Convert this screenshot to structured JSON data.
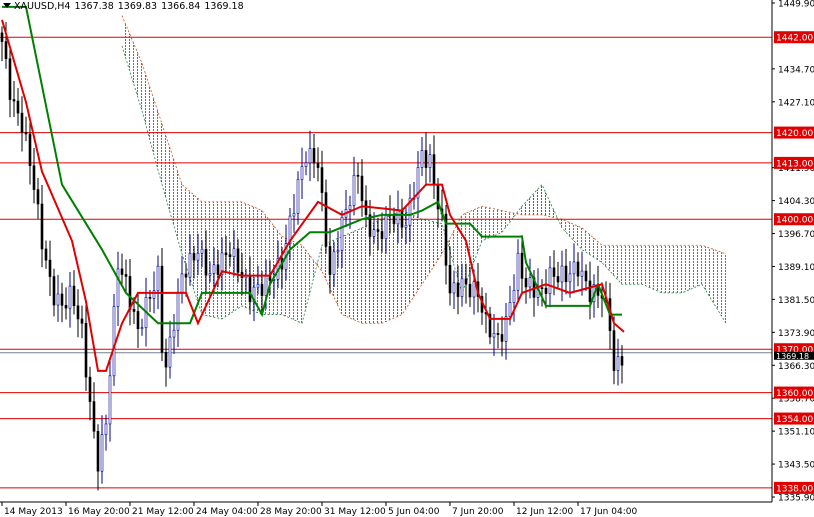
{
  "header": {
    "symbol": "XAUUSD,H4",
    "open": "1367.38",
    "high": "1369.83",
    "low": "1366.84",
    "close": "1369.18"
  },
  "chart_data": {
    "type": "candlestick",
    "title": "XAUUSD,H4",
    "ylim": [
      1335.9,
      1449.9
    ],
    "y_ticks": [
      "1449.90",
      "1434.70",
      "1427.10",
      "1411.90",
      "1404.30",
      "1396.70",
      "1389.10",
      "1381.50",
      "1373.90",
      "1366.30",
      "1358.70",
      "1351.10",
      "1343.50",
      "1335.90"
    ],
    "x_ticks": [
      {
        "bar": 0,
        "label": "14 May 2013"
      },
      {
        "bar": 16,
        "label": "16 May 20:00"
      },
      {
        "bar": 32,
        "label": "21 May 12:00"
      },
      {
        "bar": 48,
        "label": "24 May 04:00"
      },
      {
        "bar": 64,
        "label": "28 May 20:00"
      },
      {
        "bar": 80,
        "label": "31 May 12:00"
      },
      {
        "bar": 96,
        "label": "5 Jun 04:00"
      },
      {
        "bar": 112,
        "label": "7 Jun 20:00"
      },
      {
        "bar": 128,
        "label": "12 Jun 12:00"
      },
      {
        "bar": 144,
        "label": "17 Jun 04:00"
      }
    ],
    "horizontal_levels": [
      {
        "price": 1442.0,
        "label": "1442.00"
      },
      {
        "price": 1420.0,
        "label": "1420.00"
      },
      {
        "price": 1413.0,
        "label": "1413.00"
      },
      {
        "price": 1400.0,
        "label": "1400.00"
      },
      {
        "price": 1370.0,
        "label": "1370.00"
      },
      {
        "price": 1360.0,
        "label": "1360.00"
      },
      {
        "price": 1354.0,
        "label": "1354.00"
      },
      {
        "price": 1338.0,
        "label": "1338.00"
      }
    ],
    "bid": {
      "price": 1369.18,
      "label": "1369.18"
    },
    "close_path": [
      [
        0,
        1441
      ],
      [
        2.5,
        1427
      ],
      [
        5,
        1422
      ],
      [
        7.5,
        1411
      ],
      [
        10,
        1395
      ],
      [
        12.5,
        1383
      ],
      [
        15,
        1380
      ],
      [
        17.5,
        1383
      ],
      [
        20,
        1374
      ],
      [
        22.5,
        1353
      ],
      [
        24,
        1344
      ],
      [
        26,
        1353
      ],
      [
        29,
        1390
      ],
      [
        31,
        1385
      ],
      [
        34,
        1374
      ],
      [
        36,
        1380
      ],
      [
        39,
        1387
      ],
      [
        40.5,
        1363
      ],
      [
        42.5,
        1374
      ],
      [
        45,
        1387
      ],
      [
        49,
        1393
      ],
      [
        52,
        1387
      ],
      [
        57,
        1393
      ],
      [
        62,
        1383
      ],
      [
        66,
        1385
      ],
      [
        70,
        1390
      ],
      [
        74,
        1408
      ],
      [
        76,
        1415
      ],
      [
        79,
        1413
      ],
      [
        80,
        1404
      ],
      [
        82,
        1387
      ],
      [
        85,
        1399
      ],
      [
        89,
        1411
      ],
      [
        91,
        1399
      ],
      [
        94,
        1396
      ],
      [
        97,
        1401
      ],
      [
        101,
        1399
      ],
      [
        105,
        1415
      ],
      [
        107,
        1413
      ],
      [
        110,
        1399
      ],
      [
        112,
        1383
      ],
      [
        115,
        1385
      ],
      [
        119,
        1383
      ],
      [
        121,
        1376
      ],
      [
        124,
        1372
      ],
      [
        126,
        1376
      ],
      [
        129,
        1390
      ],
      [
        131,
        1385
      ],
      [
        135,
        1383
      ],
      [
        137,
        1387
      ],
      [
        141,
        1387
      ],
      [
        144,
        1389
      ],
      [
        147,
        1383
      ],
      [
        150,
        1383
      ],
      [
        152,
        1376
      ],
      [
        153,
        1365
      ],
      [
        155,
        1368.5
      ]
    ],
    "tenkan_sen": [
      [
        0,
        1446
      ],
      [
        6,
        1427
      ],
      [
        10,
        1411
      ],
      [
        17.5,
        1395
      ],
      [
        21,
        1381
      ],
      [
        24,
        1365
      ],
      [
        26,
        1365
      ],
      [
        30,
        1376
      ],
      [
        34,
        1383
      ],
      [
        37,
        1383
      ],
      [
        46,
        1383
      ],
      [
        49,
        1376
      ],
      [
        55,
        1388
      ],
      [
        60,
        1387
      ],
      [
        67,
        1387
      ],
      [
        72,
        1395
      ],
      [
        79,
        1404
      ],
      [
        85,
        1401
      ],
      [
        90,
        1403
      ],
      [
        100,
        1402
      ],
      [
        106,
        1408
      ],
      [
        110,
        1408
      ],
      [
        112,
        1401
      ],
      [
        116,
        1395
      ],
      [
        119,
        1383
      ],
      [
        122,
        1377
      ],
      [
        127,
        1377
      ],
      [
        130,
        1383
      ],
      [
        136,
        1385
      ],
      [
        142,
        1383
      ],
      [
        150,
        1385
      ],
      [
        153,
        1376
      ],
      [
        155.5,
        1374
      ]
    ],
    "kijun_sen": [
      [
        0,
        1449
      ],
      [
        6,
        1449
      ],
      [
        15,
        1408
      ],
      [
        25,
        1393
      ],
      [
        31,
        1383
      ],
      [
        39,
        1376
      ],
      [
        47,
        1376
      ],
      [
        50,
        1383
      ],
      [
        62,
        1383
      ],
      [
        65,
        1378
      ],
      [
        67,
        1385
      ],
      [
        72,
        1393
      ],
      [
        77,
        1397
      ],
      [
        82,
        1397
      ],
      [
        90,
        1400
      ],
      [
        95,
        1401
      ],
      [
        102,
        1401
      ],
      [
        105,
        1402
      ],
      [
        109,
        1404
      ],
      [
        111,
        1399
      ],
      [
        117,
        1399
      ],
      [
        120,
        1396
      ],
      [
        130,
        1396
      ],
      [
        131,
        1390
      ],
      [
        136,
        1380
      ],
      [
        147,
        1380
      ],
      [
        149,
        1385
      ],
      [
        152,
        1378
      ],
      [
        155,
        1378
      ]
    ],
    "senkou_span_a": [
      [
        30,
        1440
      ],
      [
        35,
        1425
      ],
      [
        40,
        1408
      ],
      [
        45,
        1392
      ],
      [
        50,
        1378
      ],
      [
        55,
        1377
      ],
      [
        60,
        1380
      ],
      [
        65,
        1378
      ],
      [
        70,
        1378
      ],
      [
        75,
        1376
      ],
      [
        80,
        1394
      ],
      [
        85,
        1396
      ],
      [
        90,
        1398
      ],
      [
        95,
        1400
      ],
      [
        100,
        1402
      ],
      [
        105,
        1400
      ],
      [
        110,
        1399
      ],
      [
        115,
        1383
      ],
      [
        120,
        1395
      ],
      [
        125,
        1397
      ],
      [
        130,
        1403
      ],
      [
        135,
        1408
      ],
      [
        140,
        1398
      ],
      [
        145,
        1393
      ],
      [
        150,
        1390
      ],
      [
        155,
        1385
      ],
      [
        160,
        1385
      ],
      [
        165,
        1383
      ],
      [
        170,
        1383
      ],
      [
        175,
        1385
      ],
      [
        181,
        1376
      ]
    ],
    "senkou_span_b": [
      [
        30,
        1447
      ],
      [
        35,
        1436
      ],
      [
        40,
        1422
      ],
      [
        45,
        1408
      ],
      [
        50,
        1404
      ],
      [
        55,
        1404
      ],
      [
        60,
        1404
      ],
      [
        65,
        1402
      ],
      [
        70,
        1396
      ],
      [
        75,
        1394
      ],
      [
        80,
        1388
      ],
      [
        85,
        1378
      ],
      [
        90,
        1376
      ],
      [
        95,
        1376
      ],
      [
        100,
        1378
      ],
      [
        105,
        1385
      ],
      [
        110,
        1392
      ],
      [
        115,
        1401
      ],
      [
        120,
        1403
      ],
      [
        125,
        1402
      ],
      [
        130,
        1401
      ],
      [
        135,
        1401
      ],
      [
        140,
        1400
      ],
      [
        145,
        1398
      ],
      [
        150,
        1394
      ],
      [
        155,
        1394
      ],
      [
        160,
        1394
      ],
      [
        165,
        1394
      ],
      [
        170,
        1394
      ],
      [
        175,
        1394
      ],
      [
        181,
        1392
      ]
    ]
  },
  "colors": {
    "level": "#e00000",
    "tenkan": "#e00000",
    "kijun": "#008000",
    "cloud_bear": "#c85020",
    "cloud_bull": "#208040",
    "candle_up": "#00008b",
    "candle_down": "#000000",
    "bid_line": "#708090"
  }
}
